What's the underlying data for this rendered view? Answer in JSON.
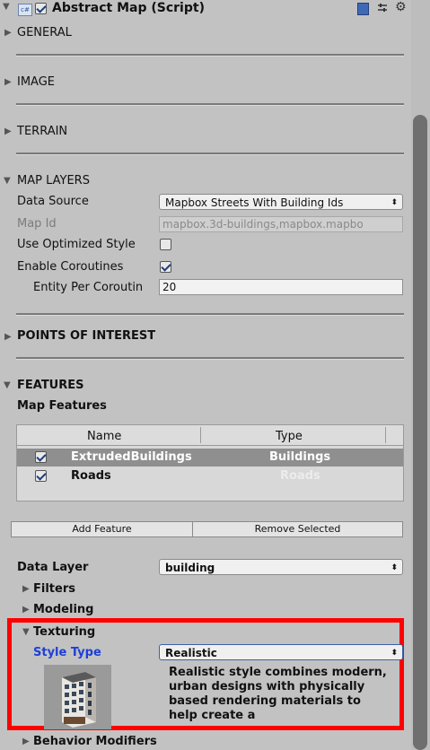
{
  "component": {
    "title": "Abstract Map (Script)",
    "enabled": true,
    "icon": "script-cs-icon",
    "header_icons": [
      "book-help-icon",
      "preset-sliders-icon",
      "gear-icon"
    ]
  },
  "sections": {
    "general": "GENERAL",
    "image": "IMAGE",
    "terrain": "TERRAIN",
    "map_layers": "MAP LAYERS",
    "points_of_interest": "POINTS OF INTEREST",
    "features": "FEATURES"
  },
  "map_layers": {
    "data_source_label": "Data Source",
    "data_source_value": "Mapbox Streets With Building Ids",
    "map_id_label": "Map Id",
    "map_id_value": "mapbox.3d-buildings,mapbox.mapbo",
    "use_optimized_style_label": "Use Optimized Style",
    "use_optimized_style": false,
    "enable_coroutines_label": "Enable Coroutines",
    "enable_coroutines": true,
    "entity_per_coroutine_label": "Entity Per Coroutin",
    "entity_per_coroutine_value": "20"
  },
  "features": {
    "map_features_label": "Map Features",
    "table": {
      "headers": [
        "Name",
        "Type"
      ],
      "rows": [
        {
          "checked": true,
          "name": "ExtrudedBuildings",
          "type": "Buildings",
          "selected": true
        },
        {
          "checked": true,
          "name": "Roads",
          "type": "Roads",
          "selected": false
        }
      ]
    },
    "add_feature": "Add Feature",
    "remove_selected": "Remove Selected",
    "data_layer_label": "Data Layer",
    "data_layer_value": "building",
    "filters": "Filters",
    "modeling": "Modeling",
    "texturing": "Texturing",
    "style_type_label": "Style Type",
    "style_type_value": "Realistic",
    "style_description": "Realistic style combines modern, urban designs with physically based rendering materials to help create a",
    "behavior_modifiers": "Behavior Modifiers"
  },
  "colors": {
    "panel_bg": "#c2c2c2",
    "highlight_red": "#ff0000",
    "selected_row": "#8f8f8f",
    "style_label_blue": "#1e3fd6"
  }
}
